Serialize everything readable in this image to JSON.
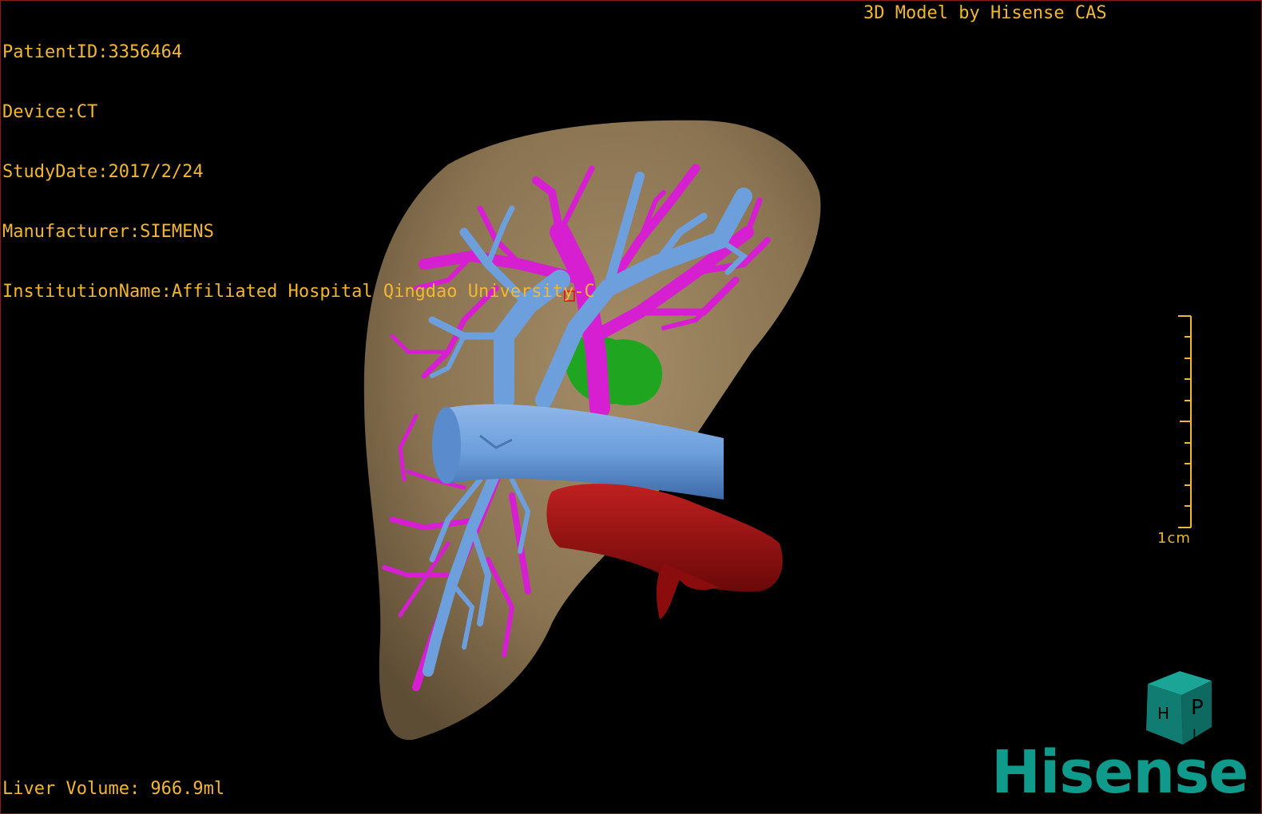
{
  "patient_info": {
    "patient_id": "PatientID:3356464",
    "device": "Device:CT",
    "study_date": "StudyDate:2017/2/24",
    "manufacturer": "Manufacturer:SIEMENS",
    "institution": "InstitutionName:Affiliated Hospital Qingdao University-C"
  },
  "model_credit": "3D Model by Hisense CAS",
  "liver_volume": "Liver Volume: 966.9ml",
  "scale_bar": {
    "label": "1cm"
  },
  "orientation_cube": {
    "faces": [
      "P",
      "H",
      "L"
    ],
    "icon": "orientation-cube-icon"
  },
  "logo": {
    "text": "Hisense",
    "color": "#0f9a8c"
  },
  "colors": {
    "text": "#f2b632",
    "liver": "#8b7452",
    "hepatic_vein": "#6d9fdc",
    "portal_vein": "#d61fd0",
    "artery": "#a30f0f",
    "gallbladder": "#1fa51f",
    "cube": "#14837a"
  }
}
